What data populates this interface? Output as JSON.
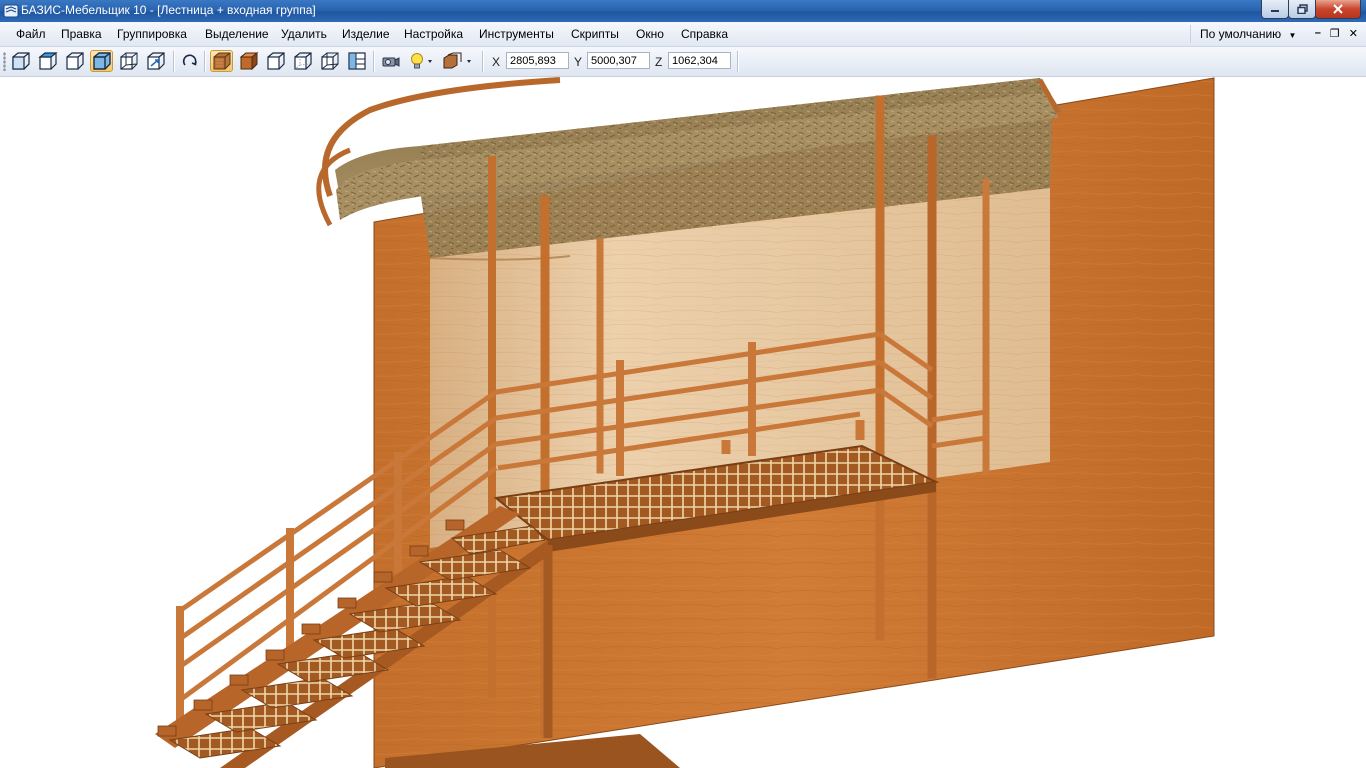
{
  "window": {
    "title": "БАЗИС-Мебельщик 10 - [Лестница + входная группа]"
  },
  "menu": {
    "items": [
      "Файл",
      "Правка",
      "Группировка",
      "Выделение",
      "Удалить",
      "Изделие",
      "Настройка",
      "Инструменты",
      "Скрипты",
      "Окно",
      "Справка"
    ],
    "preset": "По умолчанию"
  },
  "toolbar": {
    "view_buttons": [
      "front-view-icon",
      "top-view-icon",
      "left-view-icon",
      "isometric-view-icon",
      "right-view-icon",
      "axis-view-icon"
    ],
    "rotate_button": "rotate-icon",
    "render_modes": [
      "textured-render-icon",
      "shaded-render-icon",
      "wireframe-render-icon",
      "hidden-lines-icon",
      "outline-render-icon",
      "layout-panel-icon"
    ],
    "tools": [
      "camera-icon",
      "light-bulb-icon",
      "material-stack-icon"
    ],
    "active": [
      "isometric-view-icon",
      "textured-render-icon"
    ]
  },
  "coords": {
    "x_label": "X",
    "x": "2805,893",
    "y_label": "Y",
    "y": "5000,307",
    "z_label": "Z",
    "z": "1062,304"
  },
  "colors": {
    "titlebar": "#2a64b0",
    "wood": "#c8762f",
    "wood_dark": "#9a5420",
    "rail": "#cc7d3c",
    "back_panel": "#e8c7a0",
    "roof": "#a08a5c"
  }
}
